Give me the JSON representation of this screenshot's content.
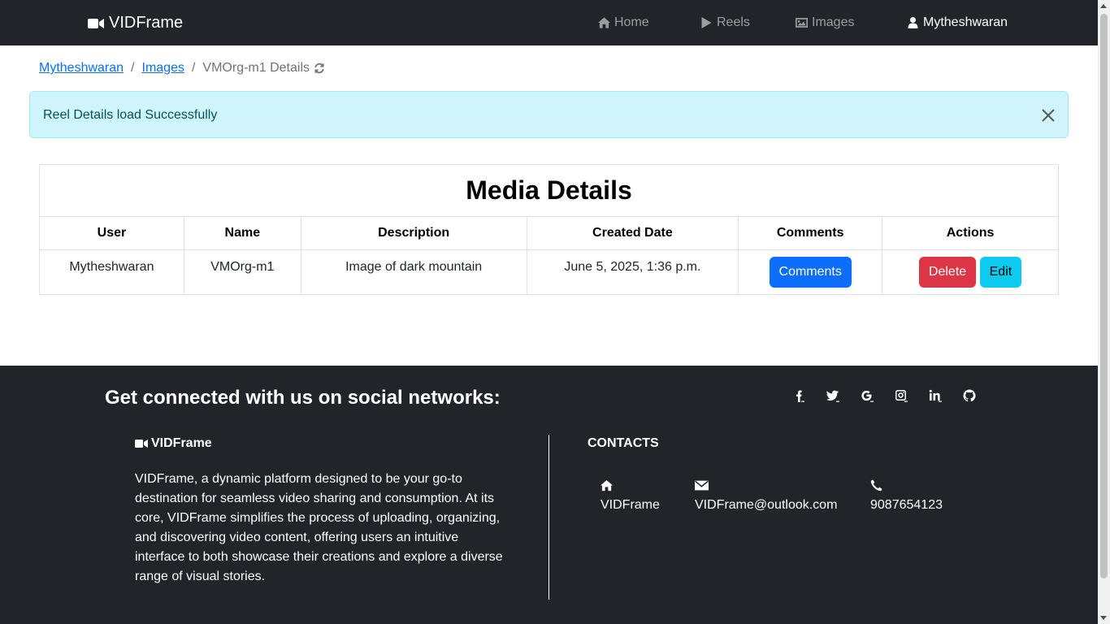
{
  "navbar": {
    "brand": "VIDFrame",
    "items": [
      {
        "label": "Home",
        "icon": "home-icon"
      },
      {
        "label": "Reels",
        "icon": "play-icon"
      },
      {
        "label": "Images",
        "icon": "image-icon"
      },
      {
        "label": "Mytheshwaran",
        "icon": "user-icon",
        "active": true
      }
    ]
  },
  "breadcrumb": {
    "items": [
      "Mytheshwaran",
      "Images"
    ],
    "current": "VMOrg-m1 Details"
  },
  "alert": {
    "message": "Reel Details load Successfully",
    "color": "#cff4fc"
  },
  "table": {
    "title": "Media Details",
    "headers": [
      "User",
      "Name",
      "Description",
      "Created Date",
      "Comments",
      "Actions"
    ],
    "row": {
      "user": "Mytheshwaran",
      "name": "VMOrg-m1",
      "description": "Image of dark mountain",
      "created": "June 5, 2025, 1:36 p.m."
    },
    "buttons": {
      "comments": "Comments",
      "delete": "Delete",
      "edit": "Edit"
    }
  },
  "footer": {
    "social_heading": "Get connected with us on social networks:",
    "social_icons": [
      "facebook-icon",
      "twitter-icon",
      "google-icon",
      "instagram-icon",
      "linkedin-icon",
      "github-icon"
    ],
    "brand": "VIDFrame",
    "description": "VIDFrame, a dynamic platform designed to be your go-to destination for seamless video sharing and consumption. At its core, VIDFrame simplifies the process of uploading, organizing, and discovering video content, offering users an intuitive interface to both showcase their creations and explore a diverse range of visual stories.",
    "contacts_heading": "CONTACTS",
    "contacts": {
      "address": "VIDFrame",
      "email": "VIDFrame@outlook.com",
      "phone": "9087654123"
    }
  },
  "colors": {
    "dark": "#212529",
    "primary": "#0d6efd",
    "danger": "#dc3545",
    "info": "#0dcaf0"
  }
}
